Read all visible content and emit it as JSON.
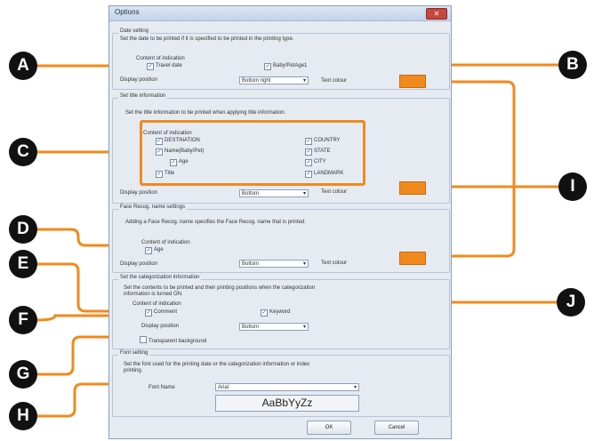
{
  "window": {
    "title": "Options",
    "close": "✕"
  },
  "date": {
    "group": "Date setting",
    "desc": "Set the date to be printed if it is specified to be printed in the printing type.",
    "content_label": "Content of indication",
    "travel_date": "Travel date",
    "baby": "Baby/PetAge1",
    "display_label": "Display position",
    "position": "Bottom right",
    "text_colour": "Text colour"
  },
  "title": {
    "group": "Set title information",
    "desc": "Set the title information to be printed when applying title information.",
    "content_label": "Content of indication",
    "destination": "DESTINATION",
    "name": "Name(Baby/Pet)",
    "age": "Age",
    "title": "Title",
    "country": "COUNTRY",
    "state": "STATE",
    "city": "CITY",
    "landmark": "LANDMARK",
    "display_label": "Display position",
    "position": "Bottom",
    "text_colour": "Text colour"
  },
  "face": {
    "group": "Face Recog. name settings",
    "desc": "Adding a Face Recog. name specifies the Face Recog. name that is printed.",
    "content_label": "Content of indication",
    "age": "Age",
    "display_label": "Display position",
    "position": "Bottom",
    "text_colour": "Text colour"
  },
  "cat": {
    "group": "Set the categorization information",
    "desc1": "Set the contents to be printed and their printing positions when the categorization",
    "desc2": "information is turned ON.",
    "content_label": "Content of indication",
    "comment": "Comment",
    "keyword": "Keyword",
    "display_label": "Display position",
    "position": "Bottom",
    "transparent": "Transparent background"
  },
  "font": {
    "group": "Font setting",
    "desc1": "Set the font used for the printing date or the categorization information or index",
    "desc2": "printing.",
    "name_label": "Font Name",
    "font": "Arial",
    "preview": "AaBbYyZz"
  },
  "buttons": {
    "ok": "OK",
    "cancel": "Cancel"
  },
  "check": "✓",
  "arrow": "▾",
  "callouts": {
    "a": "A",
    "b": "B",
    "c": "C",
    "d": "D",
    "e": "E",
    "f": "F",
    "g": "G",
    "h": "H",
    "i": "I",
    "j": "J"
  },
  "colors": {
    "accent": "#f08a1c",
    "badge": "#111111"
  }
}
